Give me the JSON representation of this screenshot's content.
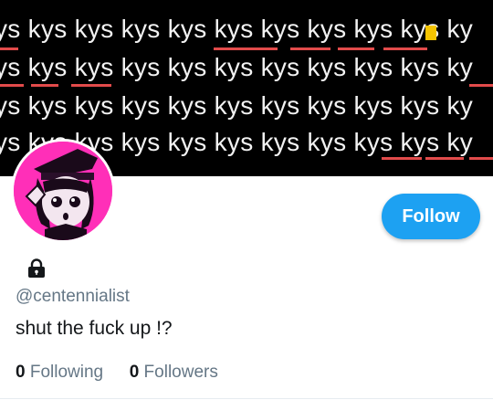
{
  "banner": {
    "rows": [
      "ys kys kys kys kys kys kys kys kys kys ky",
      "ys kys kys kys kys kys kys kys kys kys ky",
      "ys kys kys kys kys kys kys kys kys kys ky",
      "ys kys kys kys kys kys kys kys kys kys ky"
    ]
  },
  "profile": {
    "handle": "@centennialist",
    "bio": "shut the fuck up !?",
    "following_count": "0",
    "following_label": "Following",
    "followers_count": "0",
    "followers_label": "Followers",
    "locked": true
  },
  "actions": {
    "follow_label": "Follow"
  },
  "colors": {
    "accent": "#1da1f2",
    "avatar_bg": "#ff2fb8",
    "secondary_text": "#657786"
  },
  "icons": {
    "lock": "lock-icon"
  }
}
